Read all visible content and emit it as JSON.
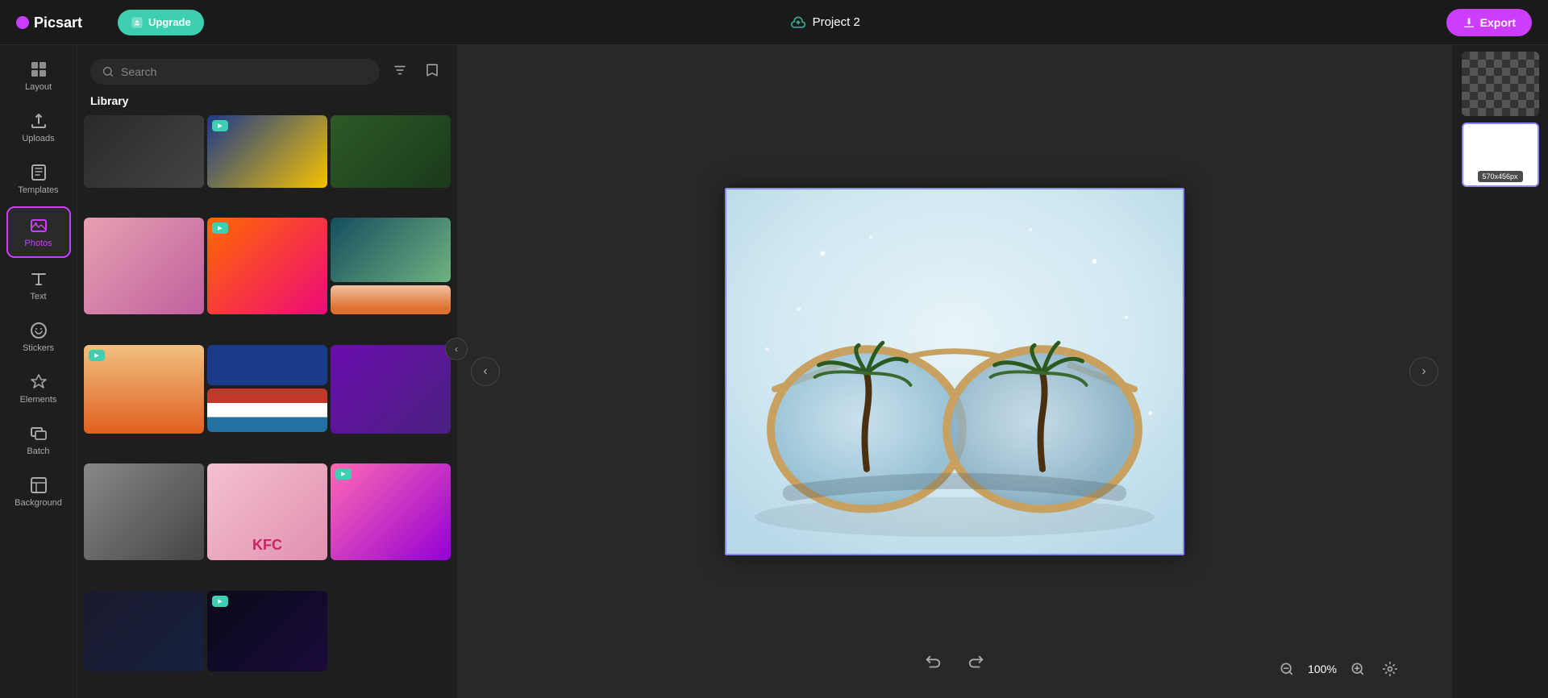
{
  "topbar": {
    "logo_text": "Picsart",
    "upgrade_label": "Upgrade",
    "project_name": "Project 2",
    "export_label": "Export"
  },
  "sidebar": {
    "items": [
      {
        "id": "layout",
        "label": "Layout",
        "icon": "grid-icon"
      },
      {
        "id": "uploads",
        "label": "Uploads",
        "icon": "upload-icon"
      },
      {
        "id": "templates",
        "label": "Templates",
        "icon": "book-icon"
      },
      {
        "id": "photos",
        "label": "Photos",
        "icon": "photo-icon",
        "active": true
      },
      {
        "id": "text",
        "label": "Text",
        "icon": "text-icon"
      },
      {
        "id": "stickers",
        "label": "Stickers",
        "icon": "sticker-icon"
      },
      {
        "id": "elements",
        "label": "Elements",
        "icon": "elements-icon"
      },
      {
        "id": "batch",
        "label": "Batch",
        "icon": "batch-icon"
      },
      {
        "id": "background",
        "label": "Background",
        "icon": "background-icon"
      }
    ]
  },
  "panel": {
    "search_placeholder": "Search",
    "library_label": "Library",
    "filter_icon": "filter-icon",
    "bookmark_icon": "bookmark-icon"
  },
  "canvas": {
    "zoom_level": "100%",
    "canvas_size": "570x456px"
  },
  "thumbnails": [
    {
      "id": "thumb1",
      "label": "",
      "type": "checkerboard"
    },
    {
      "id": "thumb2",
      "label": "570x456px",
      "type": "white",
      "active": true
    }
  ],
  "undo_icon": "undo-icon",
  "redo_icon": "redo-icon",
  "zoom_out_icon": "zoom-out-icon",
  "zoom_in_icon": "zoom-in-icon",
  "settings_icon": "settings-icon"
}
